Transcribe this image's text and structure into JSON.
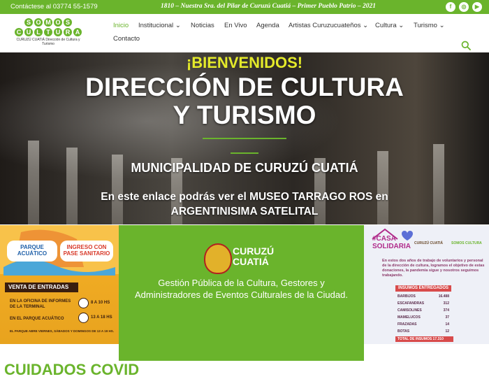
{
  "topbar": {
    "contact": "Contáctese al 03774 55-1579",
    "motto": "1810 – Nuestra Sra. del Pilar de Curuzú Cuatiá – Primer Pueblo Patrio – 2021",
    "social": [
      "f",
      "◎",
      "▶"
    ]
  },
  "logo": {
    "row1": [
      "S",
      "O",
      "M",
      "O",
      "S"
    ],
    "row2": [
      "C",
      "U",
      "L",
      "T",
      "U",
      "R",
      "A"
    ],
    "subtitle": "CURUZÚ CUATIÁ  Dirección de Cultura y Turismo"
  },
  "nav": {
    "items": [
      {
        "label": "Inicio",
        "dropdown": false
      },
      {
        "label": "Institucional",
        "dropdown": true
      },
      {
        "label": "Noticias",
        "dropdown": false
      },
      {
        "label": "En Vivo",
        "dropdown": false
      },
      {
        "label": "Agenda",
        "dropdown": false
      },
      {
        "label": "Artistas Curuzucuateños",
        "dropdown": true
      },
      {
        "label": "Cultura",
        "dropdown": true
      },
      {
        "label": "Turismo",
        "dropdown": true
      },
      {
        "label": "Contacto",
        "dropdown": false
      }
    ],
    "dropdown_glyph": "⌄"
  },
  "hero": {
    "welcome": "¡BIENVENIDOS!",
    "title": "DIRECCIÓN DE CULTURA Y TURISMO",
    "municipality": "MUNICIPALIDAD DE CURUZÚ CUATIÁ",
    "link_text": "En este enlace podrás ver el MUSEO TARRAGO ROS en ARGENTINISIMA SATELITAL"
  },
  "card1": {
    "pill1": "PARQUE ACUÁTICO",
    "pill2": "INGRESO CON PASE SANITARIO",
    "banner": "VENTA DE ENTRADAS",
    "loc1": "EN LA OFICINA DE INFORMES DE LA TERMINAL",
    "hrs1": "8 A 10 HS",
    "loc2": "EN EL PARQUE ACUÁTICO",
    "hrs2": "13 A 18 HS",
    "note": "EL PARQUE ABRE VIERNES, SÁBADOS Y DOMINGOS DE 13 A 19 HS."
  },
  "card2": {
    "city": "CURUZÚ CUATIÁ",
    "description": "Gestión Pública de la Cultura, Gestores y Administradores de Eventos Culturales de la Ciudad."
  },
  "card3": {
    "tag": "#CASA SOLIDARIA",
    "org1": "CURUZÚ CUATIÁ",
    "org2": "SOMOS CULTURA",
    "paragraph": "En estos dos años de trabajo de voluntarios y personal de la dirección de cultura, logramos el objetivo de estas donaciones, la pandemia sigue y nosotros seguimos trabajando.",
    "heading": "INSUMOS ENTREGADOS",
    "rows": [
      {
        "item": "BARBIJOS",
        "qty": "16.488"
      },
      {
        "item": "ESCAFANDRAS",
        "qty": "312"
      },
      {
        "item": "CAMISOLINES",
        "qty": "374"
      },
      {
        "item": "MAMELUCOS",
        "qty": "37"
      },
      {
        "item": "FRAZADAS",
        "qty": "14"
      },
      {
        "item": "BOTAS",
        "qty": "12"
      }
    ],
    "total": "TOTAL DE INSUMOS 17.310"
  },
  "section_title": "CUIDADOS COVID",
  "colors": {
    "brand_green": "#6ab42c",
    "welcome_yellow": "#e4ea2a",
    "card_orange": "#f5b027",
    "alert_red": "#d84b4b"
  }
}
